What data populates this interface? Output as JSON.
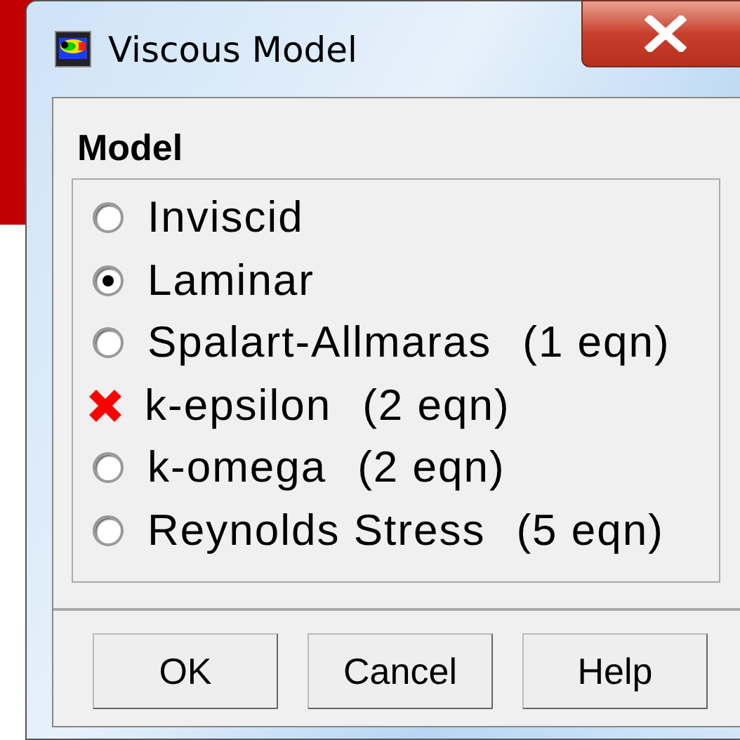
{
  "window": {
    "title": "Viscous Model"
  },
  "group": {
    "label": "Model"
  },
  "models": [
    {
      "name": "Inviscid",
      "selected": false,
      "marked": false
    },
    {
      "name": "Laminar",
      "selected": true,
      "marked": false
    },
    {
      "name": "Spalart-Allmaras",
      "eqn": "(1 eqn)",
      "selected": false,
      "marked": false
    },
    {
      "name": "k-epsilon",
      "eqn": "(2 eqn)",
      "selected": false,
      "marked": true
    },
    {
      "name": "k-omega",
      "eqn": "(2 eqn)",
      "selected": false,
      "marked": false
    },
    {
      "name": "Reynolds Stress",
      "eqn": "(5 eqn)",
      "selected": false,
      "marked": false
    }
  ],
  "buttons": [
    "OK",
    "Cancel",
    "Help"
  ]
}
